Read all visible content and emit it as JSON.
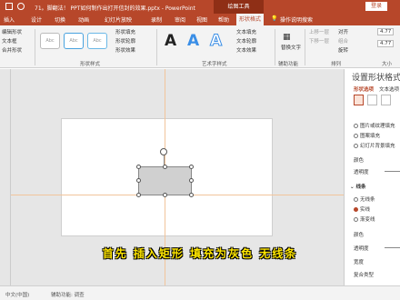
{
  "titlebar": {
    "document_title": "71。脚翻法！ PPT如何制作出打开信封的效果.pptx - PowerPoint",
    "context_tab": "绘图工具",
    "login_label": "登录"
  },
  "tabs": [
    "插入",
    "设计",
    "切换",
    "动画",
    "幻灯片放映",
    "录制",
    "审阅",
    "视图",
    "帮助",
    "形状格式",
    "操作说明搜索"
  ],
  "active_tab": "形状格式",
  "ribbon": {
    "edit_shape": "编辑形状",
    "text_box": "文本框",
    "merge_shapes": "合并形状",
    "style_sample": "Abc",
    "fill": "形状填充",
    "outline": "形状轮廓",
    "effects": "形状效果",
    "shape_styles_group": "形状样式",
    "text_fill": "文本填充",
    "text_outline": "文本轮廓",
    "text_effects": "文本效果",
    "art_text_group": "艺术字样式",
    "alt_text": "替换文字",
    "aux_group": "辅助功能",
    "bring_forward": "上移一层",
    "send_backward": "下移一层",
    "arrange": "排列",
    "align": "对齐",
    "group": "组合",
    "rotate": "旋转",
    "height": "4.77",
    "width": "4.77",
    "size_group": "大小"
  },
  "pane": {
    "title": "设置形状格式",
    "tab_shape": "形状选项",
    "tab_text": "文本选项",
    "fill_options": [
      "图片或纹理填充",
      "图案填充",
      "幻灯片背景填充"
    ],
    "color_label": "颜色",
    "transparency_label": "透明度",
    "line_section": "线条",
    "line_options": [
      "无线条",
      "实线",
      "渐变线"
    ],
    "selected_line_option": "实线",
    "width_label": "宽度",
    "compound_label": "复合类型"
  },
  "subtitle": "首先  插入矩形  填充为灰色  无线条",
  "statusbar": {
    "language": "中文(中国)",
    "accessibility": "辅助功能: 调查"
  }
}
